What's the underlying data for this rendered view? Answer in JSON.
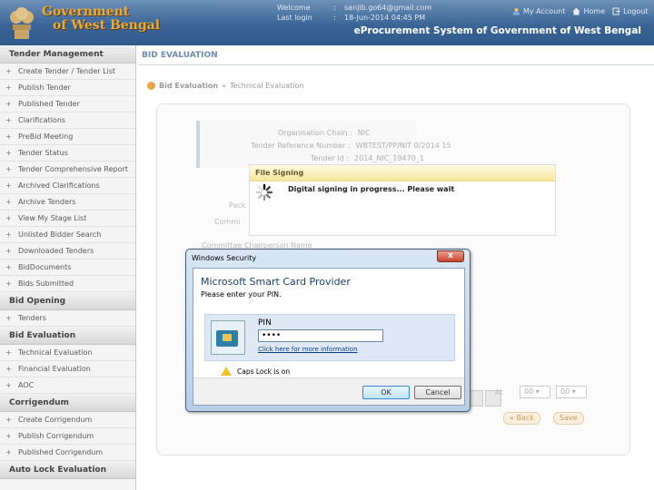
{
  "header": {
    "gov_line1": "Government",
    "gov_line2": "of West Bengal",
    "welcome_label": "Welcome",
    "welcome_value": "sanjib.go64@gmail.com",
    "lastlogin_label": "Last login",
    "lastlogin_value": "18-Jun-2014 04:45 PM",
    "colon": ":",
    "my_account": "My Account",
    "home": "Home",
    "logout": "Logout",
    "eproc_title": "eProcurement System of Government of West Bengal"
  },
  "sidebar": {
    "sections": [
      {
        "title": "Tender Management",
        "items": [
          "Create Tender / Tender List",
          "Publish Tender",
          "Published Tender",
          "Clarifications",
          "PreBid Meeting",
          "Tender Status",
          "Tender Comprehensive Report",
          "Archived Clarifications",
          "Archive Tenders",
          "View My Stage List",
          "Unlisted Bidder Search",
          "Downloaded Tenders",
          "BidDocuments",
          "Bids Submitted"
        ]
      },
      {
        "title": "Bid Opening",
        "items": [
          "Tenders"
        ]
      },
      {
        "title": "Bid Evaluation",
        "items": [
          "Technical Evaluation",
          "Financial Evaluation",
          "AOC"
        ]
      },
      {
        "title": "Corrigendum",
        "items": [
          "Create Corrigendum",
          "Publish Corrigendum",
          "Published Corrigendum"
        ]
      },
      {
        "title": "Auto Lock Evaluation",
        "items": []
      }
    ]
  },
  "main": {
    "title": "BID EVALUATION",
    "crumb1": "Bid Evaluation",
    "crumb_sep": "»",
    "crumb2": "Technical Evaluation",
    "org_label": "Organisation Chain :",
    "org_value": "NIC",
    "ref_label": "Tender Reference Number :",
    "ref_value": "WBTEST/PP/NIT 0/2014 15",
    "id_label": "Tender Id :",
    "id_value": "2014_NIC_19470_1",
    "partial1": "Pack",
    "partial2": "Commi",
    "committee_label": "Committee Chairperson Name",
    "at_label": "At",
    "sel_hour": "00",
    "sel_min": "00",
    "back_label": "« Back",
    "save_label": "Save"
  },
  "file_signing": {
    "title": "File Signing",
    "message": "Digital signing in progress... Please wait"
  },
  "win_security": {
    "title": "Windows Security",
    "close": "x",
    "heading": "Microsoft Smart Card Provider",
    "subheading": "Please enter your PIN.",
    "pin_label": "PIN",
    "pin_value": "••••",
    "more_info": "Click here for more information",
    "caps_warning": "Caps Lock is on",
    "ok": "OK",
    "cancel": "Cancel"
  }
}
